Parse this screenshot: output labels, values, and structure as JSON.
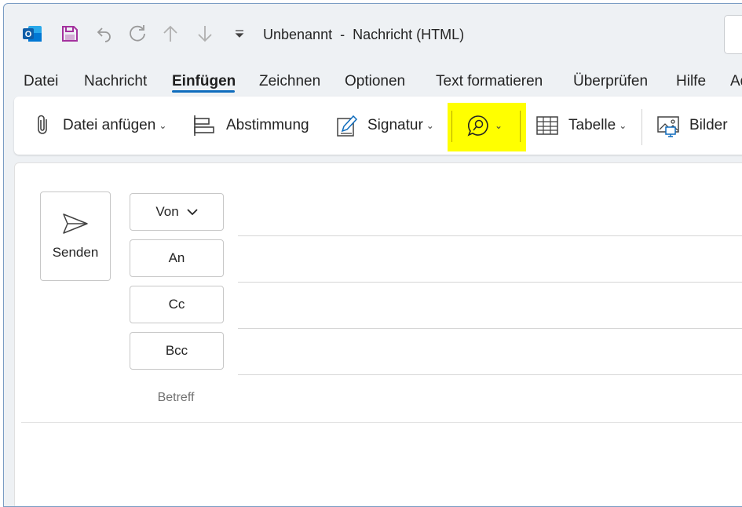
{
  "window": {
    "title": "Unbenannt  -  Nachricht (HTML)"
  },
  "quick_access": {
    "app_icon": "outlook-icon",
    "save_icon": "save-icon",
    "undo_icon": "undo-icon",
    "redo_icon": "redo-icon",
    "up_icon": "arrow-up-icon",
    "down_icon": "arrow-down-icon",
    "customize_icon": "customize-toolbar-icon"
  },
  "tabs": [
    {
      "label": "Datei"
    },
    {
      "label": "Nachricht"
    },
    {
      "label": "Einfügen",
      "active": true
    },
    {
      "label": "Zeichnen"
    },
    {
      "label": "Optionen"
    },
    {
      "label": "Text formatieren"
    },
    {
      "label": "Überprüfen"
    },
    {
      "label": "Hilfe"
    },
    {
      "label": "Ad"
    }
  ],
  "ribbon": {
    "attach_file": "Datei anfügen",
    "poll": "Abstimmung",
    "signature": "Signatur",
    "table": "Tabelle",
    "pictures": "Bilder",
    "highlight_color": "#ffff00"
  },
  "compose": {
    "send": "Senden",
    "from": "Von",
    "to": "An",
    "cc": "Cc",
    "bcc": "Bcc",
    "subject": "Betreff"
  },
  "colors": {
    "accent": "#0f6cbd",
    "window_bg": "#eef1f4"
  }
}
